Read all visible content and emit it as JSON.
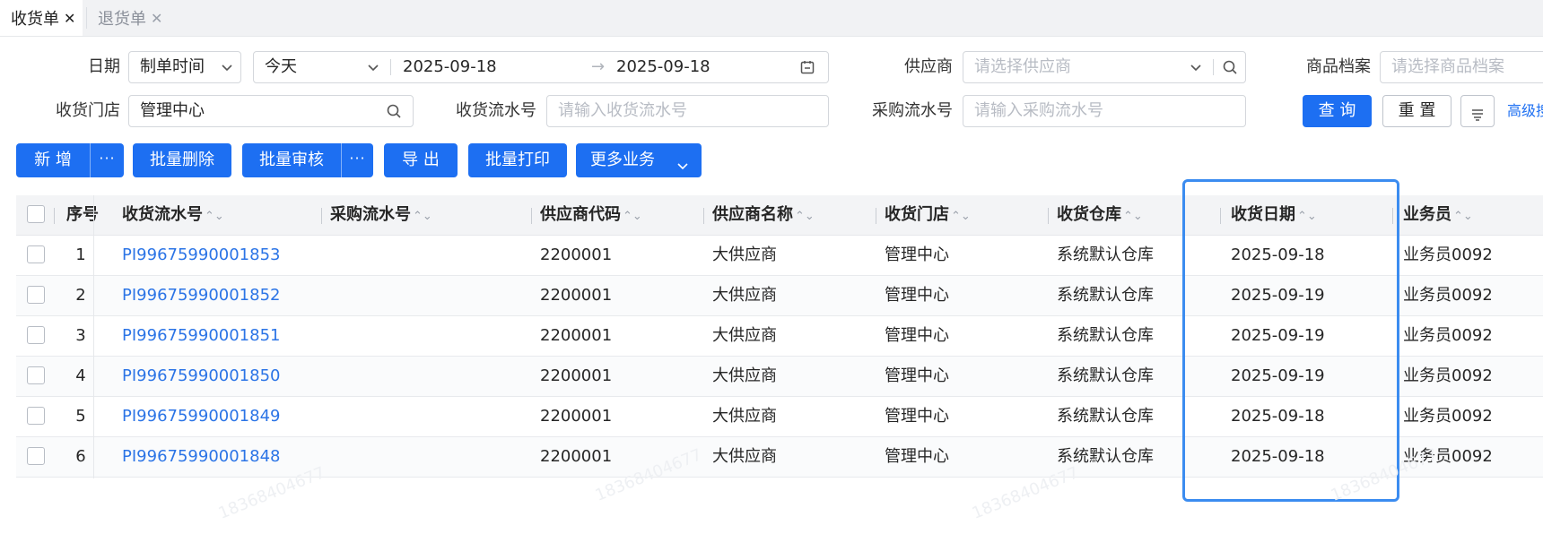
{
  "tabs": [
    {
      "label": "收货单",
      "close": "✕",
      "active": true
    },
    {
      "label": "退货单",
      "close": "✕",
      "active": false
    }
  ],
  "filters": {
    "date_label": "日期",
    "date_type": "制单时间",
    "date_preset": "今天",
    "date_from": "2025-09-18",
    "date_arrow": "→",
    "date_to": "2025-09-18",
    "supplier_label": "供应商",
    "supplier_placeholder": "请选择供应商",
    "product_label": "商品档案",
    "product_placeholder": "请选择商品档案",
    "store_label": "收货门店",
    "store_value": "管理中心",
    "receipt_no_label": "收货流水号",
    "receipt_no_placeholder": "请输入收货流水号",
    "purchase_no_label": "采购流水号",
    "purchase_no_placeholder": "请输入采购流水号",
    "query": "查 询",
    "reset": "重 置",
    "advanced": "高级搜"
  },
  "actions": {
    "add": "新 增",
    "more_dots": "···",
    "batch_delete": "批量删除",
    "batch_review": "批量审核",
    "export": "导 出",
    "batch_print": "批量打印",
    "more_business": "更多业务"
  },
  "table": {
    "columns": [
      "序号",
      "收货流水号",
      "采购流水号",
      "供应商代码",
      "供应商名称",
      "收货门店",
      "收货仓库",
      "收货日期",
      "业务员"
    ],
    "rows": [
      {
        "seq": "1",
        "receipt_no": "PI99675990001853",
        "purchase_no": "",
        "supplier_code": "2200001",
        "supplier_name": "大供应商",
        "store": "管理中心",
        "warehouse": "系统默认仓库",
        "date": "2025-09-18",
        "salesman": "业务员0092"
      },
      {
        "seq": "2",
        "receipt_no": "PI99675990001852",
        "purchase_no": "",
        "supplier_code": "2200001",
        "supplier_name": "大供应商",
        "store": "管理中心",
        "warehouse": "系统默认仓库",
        "date": "2025-09-19",
        "salesman": "业务员0092"
      },
      {
        "seq": "3",
        "receipt_no": "PI99675990001851",
        "purchase_no": "",
        "supplier_code": "2200001",
        "supplier_name": "大供应商",
        "store": "管理中心",
        "warehouse": "系统默认仓库",
        "date": "2025-09-19",
        "salesman": "业务员0092"
      },
      {
        "seq": "4",
        "receipt_no": "PI99675990001850",
        "purchase_no": "",
        "supplier_code": "2200001",
        "supplier_name": "大供应商",
        "store": "管理中心",
        "warehouse": "系统默认仓库",
        "date": "2025-09-19",
        "salesman": "业务员0092"
      },
      {
        "seq": "5",
        "receipt_no": "PI99675990001849",
        "purchase_no": "",
        "supplier_code": "2200001",
        "supplier_name": "大供应商",
        "store": "管理中心",
        "warehouse": "系统默认仓库",
        "date": "2025-09-18",
        "salesman": "业务员0092"
      },
      {
        "seq": "6",
        "receipt_no": "PI99675990001848",
        "purchase_no": "",
        "supplier_code": "2200001",
        "supplier_name": "大供应商",
        "store": "管理中心",
        "warehouse": "系统默认仓库",
        "date": "2025-09-18",
        "salesman": "业务员0092"
      }
    ]
  },
  "watermark": "18368404677",
  "colors": {
    "primary": "#1d6ff2",
    "link": "#2b74e6",
    "highlight": "#3b8cf0"
  }
}
